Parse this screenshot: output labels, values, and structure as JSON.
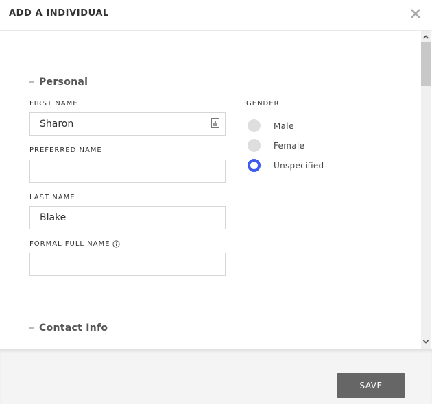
{
  "dialog": {
    "title": "ADD A INDIVIDUAL",
    "close_icon": "close-icon"
  },
  "sections": {
    "personal": {
      "title": "Personal",
      "collapse_icon": "minus-icon"
    },
    "contact": {
      "title": "Contact Info",
      "collapse_icon": "minus-icon"
    }
  },
  "fields": {
    "first_name": {
      "label": "FIRST NAME",
      "value": "Sharon",
      "placeholder": "",
      "icon": "contact-card-icon"
    },
    "preferred_name": {
      "label": "PREFERRED NAME",
      "value": "",
      "placeholder": ""
    },
    "last_name": {
      "label": "LAST NAME",
      "value": "Blake",
      "placeholder": ""
    },
    "formal_full_name": {
      "label": "FORMAL FULL NAME",
      "value": "",
      "placeholder": "",
      "icon": "info-icon"
    }
  },
  "gender": {
    "label": "GENDER",
    "options": [
      {
        "label": "Male",
        "checked": false
      },
      {
        "label": "Female",
        "checked": false
      },
      {
        "label": "Unspecified",
        "checked": true
      }
    ],
    "accent_color": "#3d5af1"
  },
  "footer": {
    "save_label": "SAVE"
  },
  "scrollbar": {
    "up_icon": "chevron-up-icon",
    "down_icon": "chevron-down-icon"
  }
}
